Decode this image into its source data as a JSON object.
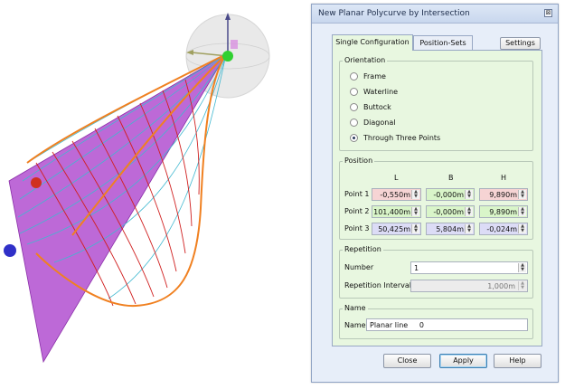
{
  "dialog": {
    "title": "New Planar Polycurve by Intersection",
    "close_glyph": "⊠",
    "tabs": [
      {
        "label": "Single Configuration",
        "active": true
      },
      {
        "label": "Position-Sets",
        "active": false
      }
    ],
    "settings_label": "Settings",
    "orientation": {
      "title": "Orientation",
      "options": [
        {
          "label": "Frame",
          "selected": false
        },
        {
          "label": "Waterline",
          "selected": false
        },
        {
          "label": "Buttock",
          "selected": false
        },
        {
          "label": "Diagonal",
          "selected": false
        },
        {
          "label": "Through Three Points",
          "selected": true
        }
      ]
    },
    "position": {
      "title": "Position",
      "headers": [
        "L",
        "B",
        "H"
      ],
      "rows": [
        {
          "label": "Point 1",
          "values": [
            "-0,550m",
            "-0,000m",
            "9,890m"
          ]
        },
        {
          "label": "Point 2",
          "values": [
            "101,400m",
            "-0,000m",
            "9,890m"
          ]
        },
        {
          "label": "Point 3",
          "values": [
            "50,425m",
            "5,804m",
            "-0,024m"
          ]
        }
      ]
    },
    "repetition": {
      "title": "Repetition",
      "number_label": "Number",
      "number_value": "1",
      "interval_label": "Repetition Interval",
      "interval_value": "1,000m"
    },
    "name": {
      "title": "Name",
      "label": "Name",
      "value": "Planar line     0"
    },
    "buttons": {
      "close": "Close",
      "apply": "Apply",
      "help": "Help"
    }
  },
  "colors": {
    "dialog_bg": "#e7eef9",
    "panel_bg": "#e8f7e0",
    "field_pink": "#f6d4d4",
    "field_green": "#d9f5c9",
    "field_lavender": "#dcdcf6",
    "plane_magenta": "#b14fd0",
    "wire_orange": "#f08020",
    "wire_red": "#d02020",
    "wire_cyan": "#40b8d0"
  },
  "icons": [
    "close-icon",
    "gizmo-sphere-icon",
    "spin-arrows-icon"
  ]
}
